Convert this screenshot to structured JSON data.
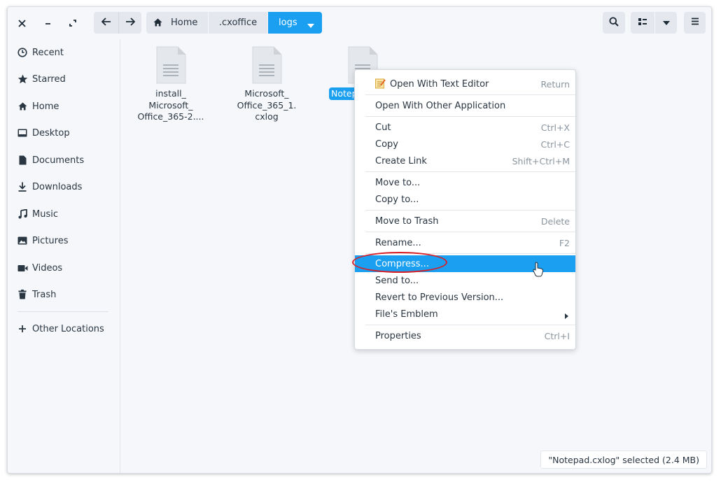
{
  "window_controls": {
    "close": "close-icon",
    "minimize": "minimize-icon",
    "maximize": "maximize-icon"
  },
  "nav": {
    "back": "back-arrow-icon",
    "forward": "forward-arrow-icon"
  },
  "breadcrumb": [
    {
      "label": "Home",
      "icon": "home-icon"
    },
    {
      "label": ".cxoffice"
    },
    {
      "label": "logs",
      "active": true
    }
  ],
  "toolbar": {
    "search": "search-icon",
    "view_list": "list-view-icon",
    "view_dropdown": "chevron-down-icon",
    "menu": "hamburger-menu-icon"
  },
  "sidebar": {
    "items": [
      {
        "label": "Recent",
        "icon": "clock-icon"
      },
      {
        "label": "Starred",
        "icon": "star-icon"
      },
      {
        "label": "Home",
        "icon": "home-icon"
      },
      {
        "label": "Desktop",
        "icon": "desktop-icon"
      },
      {
        "label": "Documents",
        "icon": "document-icon"
      },
      {
        "label": "Downloads",
        "icon": "download-icon"
      },
      {
        "label": "Music",
        "icon": "music-icon"
      },
      {
        "label": "Pictures",
        "icon": "picture-icon"
      },
      {
        "label": "Videos",
        "icon": "video-icon"
      },
      {
        "label": "Trash",
        "icon": "trash-icon"
      }
    ],
    "other_locations": {
      "label": "Other Locations",
      "icon": "plus-icon"
    }
  },
  "files": [
    {
      "line1": "install_",
      "line2": "Microsoft_",
      "line3": "Office_365-2...."
    },
    {
      "line1": "Microsoft_",
      "line2": "Office_365_1.",
      "line3": "cxlog"
    },
    {
      "line1": "Notep",
      "selected": true
    }
  ],
  "context_menu": {
    "items": [
      {
        "label": "Open With Text Editor",
        "shortcut": "Return",
        "icon": "text-editor-icon"
      },
      {
        "label": "Open With Other Application",
        "shortcut": ""
      },
      {
        "label": "Cut",
        "shortcut": "Ctrl+X"
      },
      {
        "label": "Copy",
        "shortcut": "Ctrl+C"
      },
      {
        "label": "Create Link",
        "shortcut": "Shift+Ctrl+M"
      },
      {
        "label": "Move to...",
        "shortcut": ""
      },
      {
        "label": "Copy to...",
        "shortcut": ""
      },
      {
        "label": "Move to Trash",
        "shortcut": "Delete"
      },
      {
        "label": "Rename...",
        "shortcut": "F2"
      },
      {
        "label": "Compress...",
        "shortcut": "",
        "highlighted": true
      },
      {
        "label": "Send to...",
        "shortcut": ""
      },
      {
        "label": "Revert to Previous Version...",
        "shortcut": ""
      },
      {
        "label": "File's Emblem",
        "shortcut": "",
        "submenu": "chevron-right-icon"
      },
      {
        "label": "Properties",
        "shortcut": "Ctrl+I"
      }
    ]
  },
  "status_bar": {
    "text": "\"Notepad.cxlog\" selected  (2.4 MB)"
  },
  "colors": {
    "accent": "#1a9ff1",
    "annotation_ring": "#d81f26",
    "background": "#f5f7fa"
  }
}
